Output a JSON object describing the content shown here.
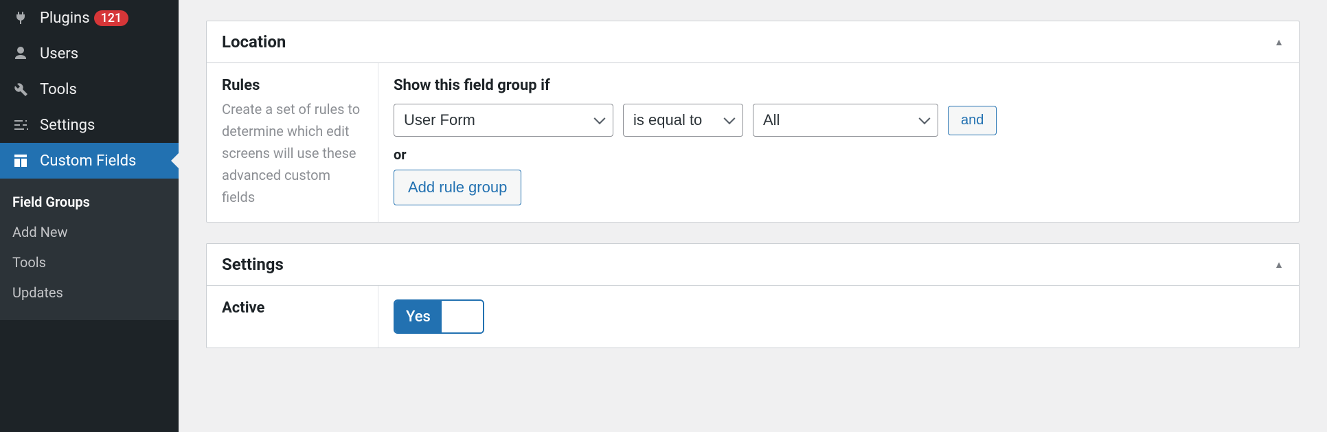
{
  "colors": {
    "accent": "#2271b1",
    "badge": "#d63638",
    "sidebar": "#1d2327"
  },
  "sidebar": {
    "items": [
      {
        "label": "Plugins",
        "icon": "plug-icon",
        "badge": "121"
      },
      {
        "label": "Users",
        "icon": "user-icon"
      },
      {
        "label": "Tools",
        "icon": "wrench-icon"
      },
      {
        "label": "Settings",
        "icon": "sliders-icon"
      },
      {
        "label": "Custom Fields",
        "icon": "layout-icon",
        "active": true
      }
    ],
    "submenu": [
      {
        "label": "Field Groups",
        "current": true
      },
      {
        "label": "Add New"
      },
      {
        "label": "Tools"
      },
      {
        "label": "Updates"
      }
    ]
  },
  "location": {
    "title": "Location",
    "rules_heading": "Rules",
    "rules_desc": "Create a set of rules to determine which edit screens will use these advanced custom fields",
    "show_label": "Show this field group if",
    "rule": {
      "param": "User Form",
      "operator": "is equal to",
      "value": "All"
    },
    "and_label": "and",
    "or_label": "or",
    "add_rule_group_label": "Add rule group"
  },
  "settings": {
    "title": "Settings",
    "active_label": "Active",
    "active_value": "Yes"
  }
}
